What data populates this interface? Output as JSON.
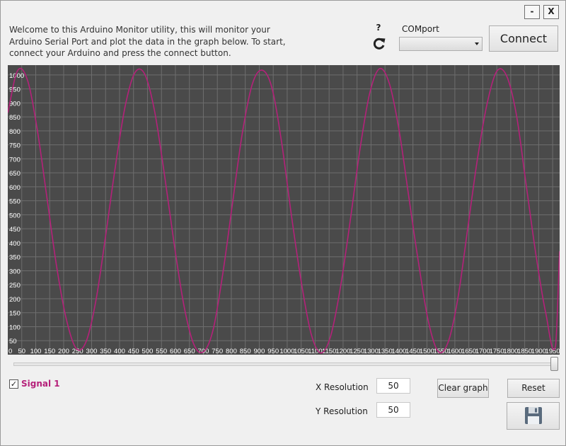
{
  "window": {
    "minimize_label": "-",
    "close_label": "X"
  },
  "intro": {
    "text": "Welcome to this Arduino Monitor utility, this will monitor your Arduino Serial Port and plot the data in the graph below. To start, connect your Arduino and press the connect button."
  },
  "toolbar": {
    "help_label": "?",
    "refresh_icon": "refresh-icon",
    "com_label": "COMport",
    "com_value": "",
    "connect_label": "Connect"
  },
  "chart_data": {
    "type": "line",
    "x_ticks": [
      "0",
      "50",
      "100",
      "150",
      "200",
      "250",
      "300",
      "350",
      "400",
      "450",
      "500",
      "550",
      "600",
      "650",
      "700",
      "750",
      "800",
      "850",
      "900",
      "950",
      "1000",
      "1050",
      "1100",
      "1150",
      "1200",
      "1250",
      "1300",
      "1350",
      "1400",
      "1450",
      "1500",
      "1550",
      "1600",
      "1650",
      "1700",
      "1750",
      "1800",
      "1850",
      "1900",
      "1950"
    ],
    "y_ticks": [
      "50",
      "100",
      "150",
      "200",
      "250",
      "300",
      "350",
      "400",
      "450",
      "500",
      "550",
      "600",
      "650",
      "700",
      "750",
      "800",
      "850",
      "900",
      "950",
      "1000"
    ],
    "xlim": [
      0,
      1975
    ],
    "ylim": [
      0,
      1035
    ],
    "grid": true,
    "series": [
      {
        "color": "#b5217a",
        "x": [
          0,
          35,
          70,
          105,
          140,
          175,
          210,
          245,
          280,
          315,
          350,
          385,
          420,
          455,
          490,
          525,
          560,
          595,
          630,
          665,
          700,
          735,
          770,
          805,
          840,
          875,
          910,
          945,
          980,
          1015,
          1050,
          1085,
          1120,
          1155,
          1190,
          1225,
          1260,
          1295,
          1330,
          1365,
          1400,
          1435,
          1470,
          1505,
          1540,
          1575,
          1610,
          1645,
          1680,
          1715,
          1750,
          1785,
          1820,
          1855,
          1890,
          1925,
          1960,
          1975
        ],
        "y": [
          865,
          1015,
          983,
          807,
          562,
          314,
          125,
          22,
          46,
          191,
          423,
          673,
          888,
          1008,
          1003,
          873,
          648,
          399,
          178,
          39,
          10,
          90,
          293,
          546,
          795,
          967,
          1017,
          955,
          760,
          498,
          262,
          77,
          6,
          65,
          238,
          475,
          731,
          933,
          1022,
          971,
          805,
          566,
          328,
          120,
          12,
          42,
          196,
          444,
          694,
          895,
          1013,
          997,
          859,
          609,
          359,
          150,
          30,
          370
        ]
      }
    ],
    "background": "#4a4a4a",
    "grid_color": "#6e6e6e"
  },
  "controls": {
    "slider_value": 1.0,
    "signal_checked": "✓",
    "signal_label": "Signal 1",
    "signal_color": "#b5217a",
    "x_res_label": "X Resolution",
    "x_res_value": "50",
    "y_res_label": "Y Resolution",
    "y_res_value": "50",
    "clear_label": "Clear graph",
    "reset_label": "Reset",
    "save_icon": "floppy-disk-icon"
  }
}
